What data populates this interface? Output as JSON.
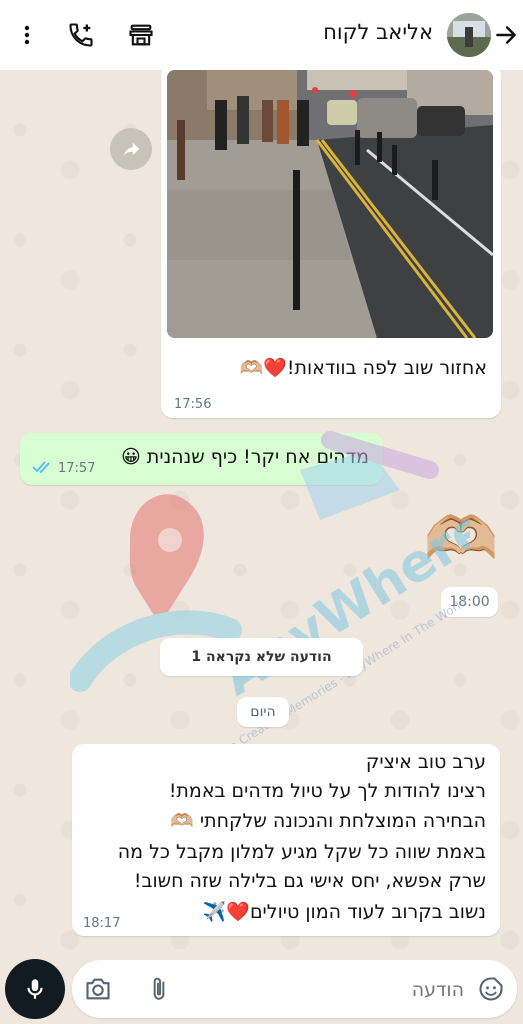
{
  "header": {
    "contact_name": "אליאב לקוח",
    "icons": [
      "back-arrow-icon",
      "avatar",
      "store-icon",
      "add-call-icon",
      "more-vert-icon"
    ]
  },
  "messages": {
    "photo_message": {
      "caption": "אחזור שוב לפה בוודאות!❤️🫶🏼",
      "time": "17:56"
    },
    "outgoing_1": {
      "text": "מדהים אח יקר! כיף שנהנית 😀",
      "time": "17:57"
    },
    "sticker_message": {
      "emoji": "🫶🏼",
      "time": "18:00"
    },
    "unread_banner": "1 הודעה שלא נקראה",
    "date_divider": "היום",
    "long_message": {
      "lines": [
        "ערב טוב איציק",
        "רצינו להודות לך על טיול מדהים באמת!",
        "הבחירה המוצלחת והנכונה שלקחתי 🫶🏼",
        "באמת שווה כל שקל מגיע למלון מקבל כל מה",
        "שרק אפשא, יחס אישי גם בלילה שזה חשוב!",
        "נשוב בקרוב לעוד המון טיולים❤️✈️"
      ],
      "time": "18:17"
    }
  },
  "watermark": {
    "brand": "AnyWhere",
    "tagline": "Go Creating Memories - AnyWhere In The World"
  },
  "composer": {
    "placeholder": "הודעה",
    "icons": [
      "emoji-icon",
      "attach-icon",
      "camera-icon",
      "mic-icon"
    ]
  },
  "colors": {
    "outgoing_bubble": "#d9fdd3",
    "incoming_bubble": "#ffffff",
    "read_ticks": "#53bdeb",
    "wallpaper": "#efe7dd"
  }
}
